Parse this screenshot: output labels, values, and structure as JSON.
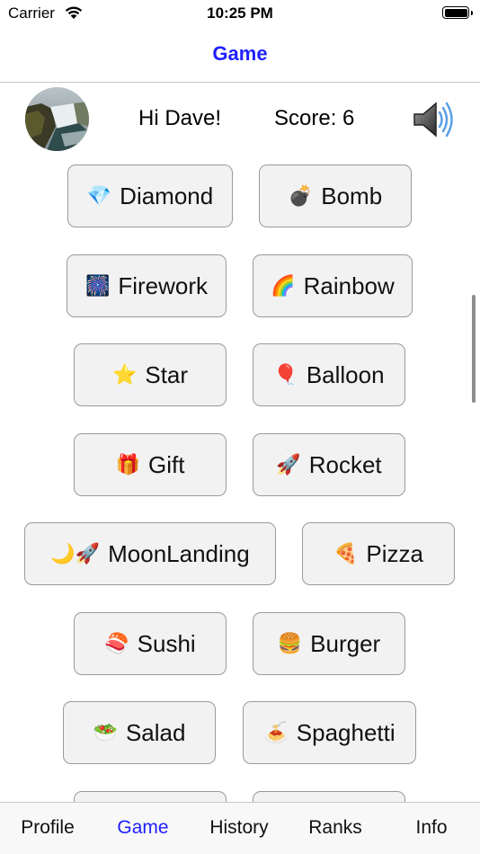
{
  "status_bar": {
    "carrier": "Carrier",
    "time": "10:25 PM"
  },
  "nav": {
    "title": "Game"
  },
  "header": {
    "greeting": "Hi Dave!",
    "score": "Score: 6"
  },
  "buttons": [
    {
      "emoji": "💎",
      "label": "Diamond"
    },
    {
      "emoji": "💣",
      "label": "Bomb"
    },
    {
      "emoji": "🎆",
      "label": "Firework"
    },
    {
      "emoji": "🌈",
      "label": "Rainbow"
    },
    {
      "emoji": "⭐",
      "label": "Star"
    },
    {
      "emoji": "🎈",
      "label": "Balloon"
    },
    {
      "emoji": "🎁",
      "label": "Gift"
    },
    {
      "emoji": "🚀",
      "label": "Rocket"
    },
    {
      "emoji": "🌙🚀",
      "label": "MoonLanding"
    },
    {
      "emoji": "🍕",
      "label": "Pizza"
    },
    {
      "emoji": "🍣",
      "label": "Sushi"
    },
    {
      "emoji": "🍔",
      "label": "Burger"
    },
    {
      "emoji": "🥗",
      "label": "Salad"
    },
    {
      "emoji": "🍝",
      "label": "Spaghetti"
    }
  ],
  "tabs": [
    {
      "label": "Profile"
    },
    {
      "label": "Game",
      "active": true
    },
    {
      "label": "History"
    },
    {
      "label": "Ranks"
    },
    {
      "label": "Info"
    }
  ],
  "colors": {
    "accent": "#1f1fff",
    "button_bg": "#f2f2f2",
    "button_border": "#9a9a9a"
  }
}
